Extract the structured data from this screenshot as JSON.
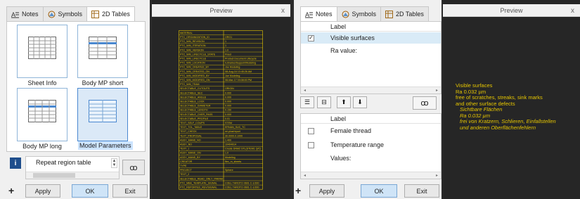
{
  "left": {
    "tabs": [
      {
        "label": "Notes",
        "icon": "notes-icon"
      },
      {
        "label": "Symbols",
        "icon": "symbols-icon"
      },
      {
        "label": "2D Tables",
        "icon": "tables-icon",
        "active": true
      }
    ],
    "thumbnails": [
      {
        "label": "Sheet Info"
      },
      {
        "label": "Body MP short"
      },
      {
        "label": "Body MP long"
      },
      {
        "label": "Model Parameters",
        "selected": true
      }
    ],
    "repeat_region_label": "Repeat region table",
    "buttons": {
      "apply": "Apply",
      "ok": "OK",
      "exit": "Exit"
    }
  },
  "preview1": {
    "title": "Preview",
    "close": "x",
    "table_rows": [
      [
        "MATERIAL",
        ""
      ],
      [
        "PTC_ORGANIZATION_ID",
        "ORG1"
      ],
      [
        "PTC_WM_REVISION",
        "1"
      ],
      [
        "PTC_WM_ITERATION",
        "1"
      ],
      [
        "PTC_WM_VERSION",
        "1.0"
      ],
      [
        "PTC_WM_LIFECYCLE_STATE",
        "Fixed"
      ],
      [
        "PTC_WM_LIFECYCLE",
        "Product Document Lifecycle"
      ],
      [
        "PTC_WM_LOCATION",
        "/Libraries/Support/Modeling"
      ],
      [
        "PTC_WM_CREATED_BY",
        "Joe Modeling"
      ],
      [
        "PTC_WM_CREATED_ON",
        "08-Aug-16 10:45:26 AM"
      ],
      [
        "PTC_WM_MODIFIED_BY",
        "Joe Modeling"
      ],
      [
        "PTC_WM_MODIFIED_ON",
        "08-Mar-17 03:08:00 PM"
      ],
      [
        "PTC_WM_TEAM",
        ""
      ],
      [
        "SELECTABLE_CUTOUTS",
        "ORIGIN"
      ],
      [
        "SELECTABLE_SEC",
        "0.000"
      ],
      [
        "SELECTABLE_ANGLE",
        "0.000"
      ],
      [
        "SELECTABLE_LOCK",
        "0.000"
      ],
      [
        "SELECTABLE_DIAMETER",
        "0.000"
      ],
      [
        "SELECTABLE_LENGTH",
        "0.150"
      ],
      [
        "SELECTABLE_OVER_PASS",
        "0.000"
      ],
      [
        "SELECTABLE_PROFILE",
        "0.01"
      ],
      [
        "TEXT_SELF_COUPS",
        "STEM"
      ],
      [
        "TEXT_TOL_TABLE",
        "ERNAN_SUC_TC"
      ],
      [
        "TEXT_CHECK",
        "mi.plus/report"
      ],
      [
        "TEXT_PROPOSAL",
        "30.0000.0.1000"
      ],
      [
        "ASSY_MAND_NO",
        "1.400"
      ],
      [
        "ASSY_NO",
        "10404914"
      ],
      [
        "TEXT_1",
        "Create DNM2 STL(STEM1 Q/C)"
      ],
      [
        "ASSY_MAND_ON",
        "1.0"
      ],
      [
        "ASSY_MAND_BY",
        "Modeling"
      ],
      [
        "CREATOR",
        "flex_m_sheets"
      ],
      [
        "TYPE",
        ""
      ],
      [
        "PROJECT",
        "Sphere"
      ],
      [
        "TEXT_2",
        ""
      ],
      [
        "SELECTABLE_READ_ONLY_PARAM",
        ""
      ],
      [
        "PTC_MBE_TEMPLATE_SIGNAL",
        "COEL THROTO 0601 C-1/300"
      ],
      [
        "PTC_REPORTED_REV/SIGNAL",
        "COEL THROTO 0601 C-1/300"
      ]
    ]
  },
  "right": {
    "tabs": [
      {
        "label": "Notes",
        "icon": "notes-icon",
        "active": true
      },
      {
        "label": "Symbols",
        "icon": "symbols-icon"
      },
      {
        "label": "2D Tables",
        "icon": "tables-icon"
      }
    ],
    "grid1": {
      "header": "Label",
      "rows": [
        {
          "label": "Visible surfaces",
          "checked": true,
          "selected": true
        },
        {
          "label": "Ra value:",
          "checked": false,
          "selected": false,
          "no_checkbox": true
        }
      ]
    },
    "toolbar_icons": [
      "list-icon",
      "indent-icon",
      "arrow-up-icon",
      "arrow-down-icon",
      "glasses-icon"
    ],
    "grid2": {
      "header": "Label",
      "rows": [
        {
          "label": "Female thread",
          "checked": false
        },
        {
          "label": "Temperature range",
          "checked": false
        },
        {
          "label": "Values:",
          "no_checkbox": true
        }
      ]
    },
    "buttons": {
      "apply": "Apply",
      "ok": "OK",
      "exit": "Exit"
    }
  },
  "preview2": {
    "title": "Preview",
    "close": "x",
    "lines": [
      "Visible surfaces",
      "Ra 0.032 µm",
      "free of scratches, streaks, sink marks",
      "and other surface defects",
      "Sichtbare Flächen",
      "Ra 0.032 µm",
      "frei von Kratzern, Schlieren, Einfallstellen",
      "und anderen Oberflächenfehlern"
    ],
    "italic_from": 4,
    "text_color": "#e6c600"
  }
}
